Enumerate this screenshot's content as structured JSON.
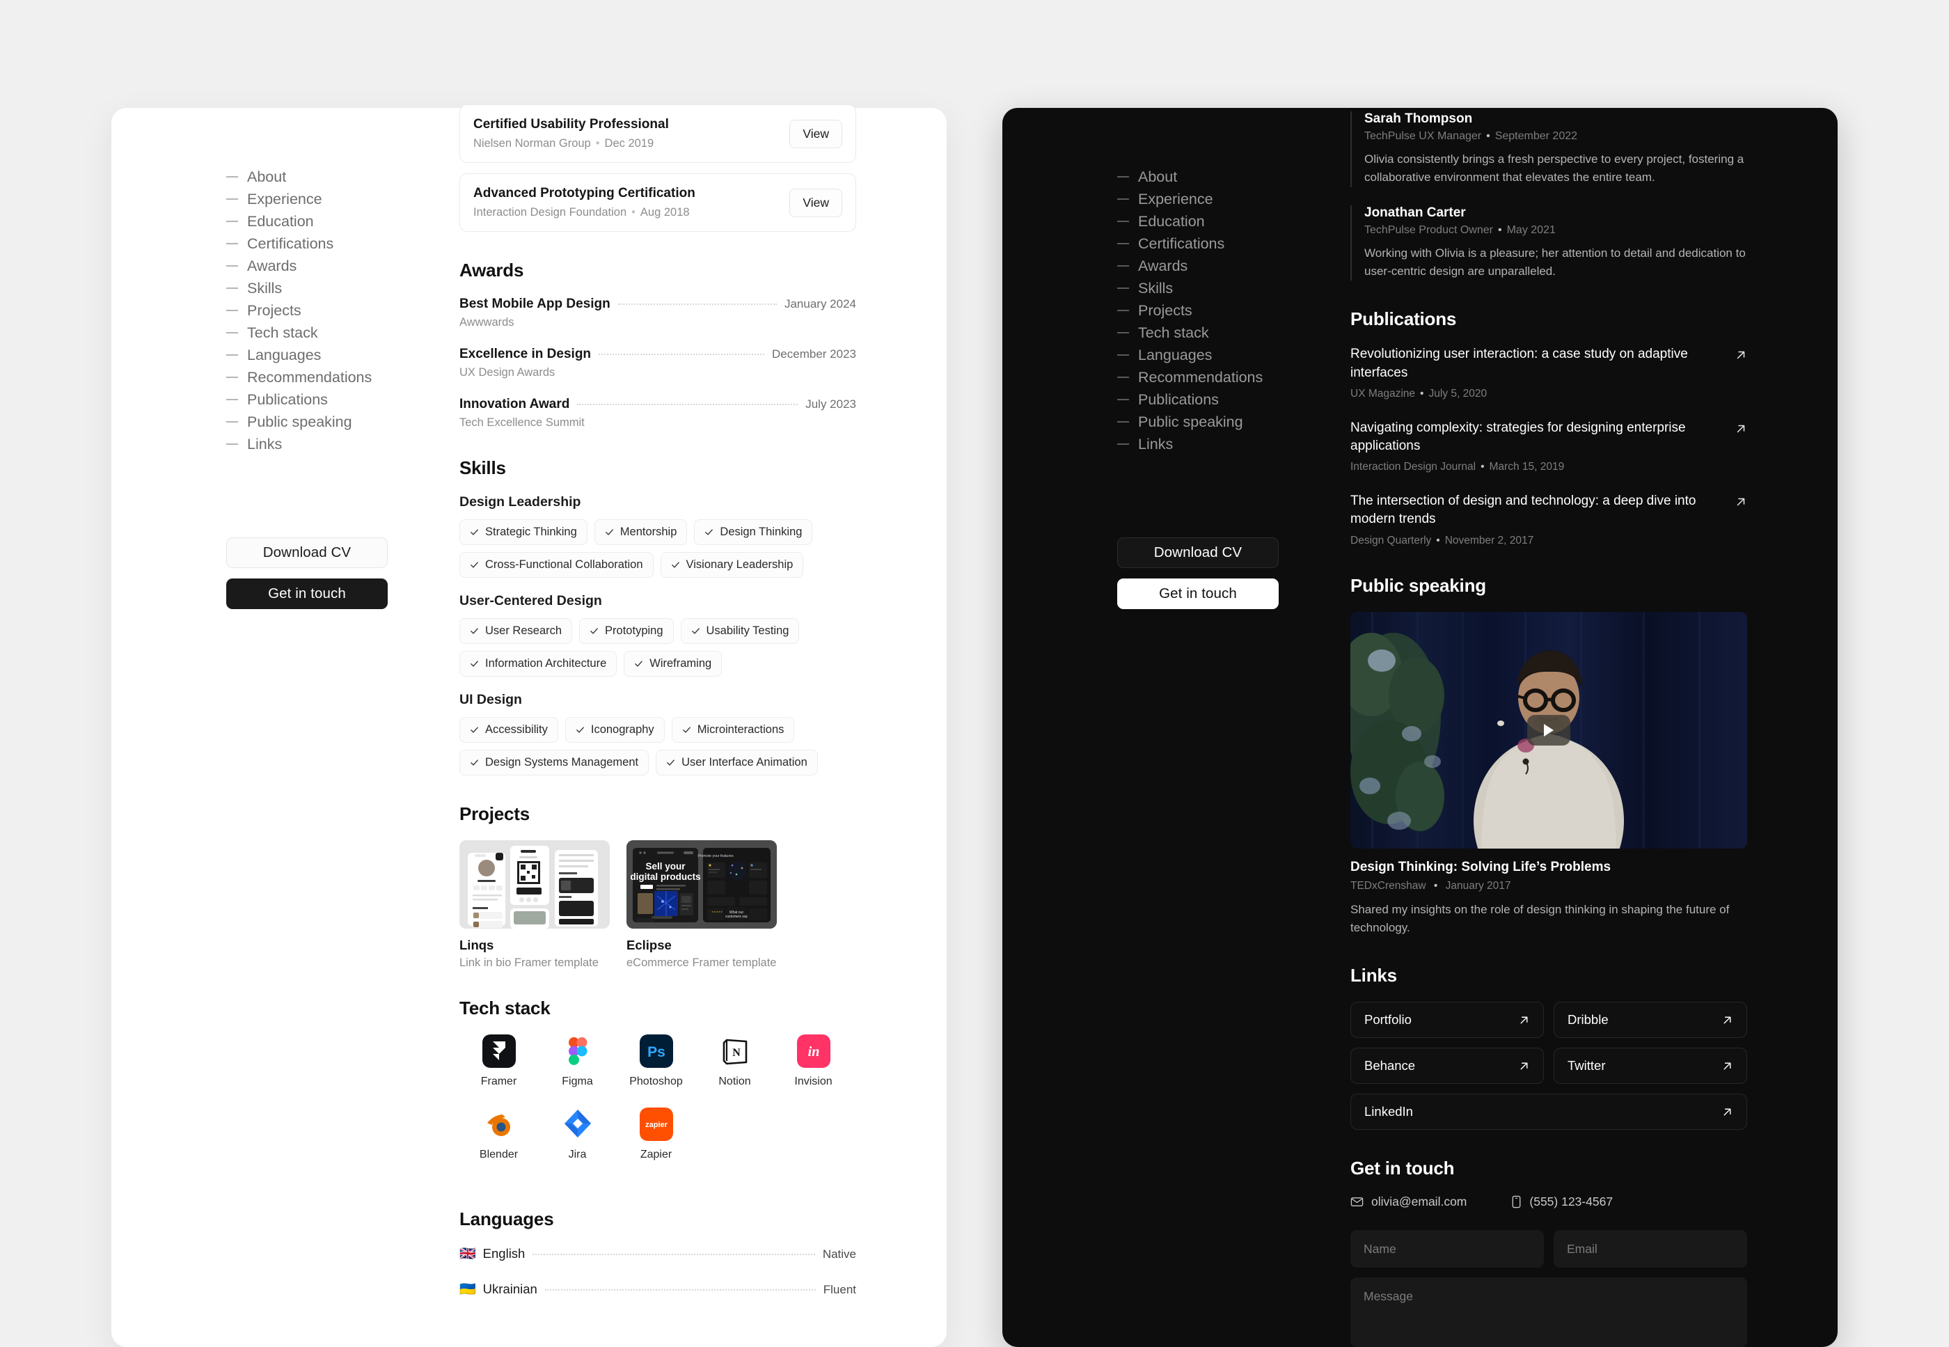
{
  "nav": {
    "items": [
      "About",
      "Experience",
      "Education",
      "Certifications",
      "Awards",
      "Skills",
      "Projects",
      "Tech stack",
      "Languages",
      "Recommendations",
      "Publications",
      "Public speaking",
      "Links"
    ],
    "download_cv": "Download CV",
    "get_in_touch": "Get in touch"
  },
  "certifications": [
    {
      "name": "Certified Usability Professional",
      "org": "Nielsen Norman Group",
      "date": "Dec 2019",
      "action": "View"
    },
    {
      "name": "Advanced Prototyping Certification",
      "org": "Interaction Design Foundation",
      "date": "Aug 2018",
      "action": "View"
    }
  ],
  "awards": {
    "title": "Awards",
    "items": [
      {
        "name": "Best Mobile App Design",
        "org": "Awwwards",
        "date": "January 2024"
      },
      {
        "name": "Excellence in Design",
        "org": "UX Design Awards",
        "date": "December 2023"
      },
      {
        "name": "Innovation Award",
        "org": "Tech Excellence Summit",
        "date": "July 2023"
      }
    ]
  },
  "skills": {
    "title": "Skills",
    "groups": [
      {
        "name": "Design Leadership",
        "items": [
          "Strategic Thinking",
          "Mentorship",
          "Design Thinking",
          "Cross-Functional Collaboration",
          "Visionary Leadership"
        ]
      },
      {
        "name": "User-Centered Design",
        "items": [
          "User Research",
          "Prototyping",
          "Usability Testing",
          "Information Architecture",
          "Wireframing"
        ]
      },
      {
        "name": "UI Design",
        "items": [
          "Accessibility",
          "Iconography",
          "Microinteractions",
          "Design Systems Management",
          "User Interface Animation"
        ]
      }
    ]
  },
  "projects": {
    "title": "Projects",
    "items": [
      {
        "name": "Linqs",
        "desc": "Link in bio Framer template"
      },
      {
        "name": "Eclipse",
        "desc": "eCommerce Framer template"
      }
    ]
  },
  "tech_stack": {
    "title": "Tech stack",
    "items": [
      {
        "name": "Framer",
        "icon": "framer-icon"
      },
      {
        "name": "Figma",
        "icon": "figma-icon"
      },
      {
        "name": "Photoshop",
        "icon": "photoshop-icon"
      },
      {
        "name": "Notion",
        "icon": "notion-icon"
      },
      {
        "name": "Invision",
        "icon": "invision-icon"
      },
      {
        "name": "Blender",
        "icon": "blender-icon"
      },
      {
        "name": "Jira",
        "icon": "jira-icon"
      },
      {
        "name": "Zapier",
        "icon": "zapier-icon"
      }
    ]
  },
  "languages": {
    "title": "Languages",
    "items": [
      {
        "flag": "🇬🇧",
        "name": "English",
        "level": "Native"
      },
      {
        "flag": "🇺🇦",
        "name": "Ukrainian",
        "level": "Fluent"
      }
    ]
  },
  "recommendations": [
    {
      "name": "Sarah Thompson",
      "role": "TechPulse UX Manager",
      "date": "September 2022",
      "text": "Olivia consistently brings a fresh perspective to every project, fostering a collaborative environment that elevates the entire team."
    },
    {
      "name": "Jonathan Carter",
      "role": "TechPulse Product Owner",
      "date": "May 2021",
      "text": "Working with Olivia is a pleasure; her attention to detail and dedication to user-centric design are unparalleled."
    }
  ],
  "publications": {
    "title": "Publications",
    "items": [
      {
        "title": "Revolutionizing user interaction: a case study on adaptive interfaces",
        "source": "UX Magazine",
        "date": "July 5, 2020"
      },
      {
        "title": "Navigating complexity: strategies for designing enterprise applications",
        "source": "Interaction Design Journal",
        "date": "March 15, 2019"
      },
      {
        "title": "The intersection of design and technology: a deep dive into modern trends",
        "source": "Design Quarterly",
        "date": "November 2, 2017"
      }
    ]
  },
  "public_speaking": {
    "title": "Public speaking",
    "talk_title": "Design Thinking: Solving Life’s Problems",
    "event": "TEDxCrenshaw",
    "date": "January 2017",
    "description": "Shared my insights on the role of design thinking in shaping the future of technology."
  },
  "links": {
    "title": "Links",
    "items": [
      "Portfolio",
      "Dribble",
      "Behance",
      "Twitter",
      "LinkedIn"
    ]
  },
  "contact": {
    "title": "Get in touch",
    "email": "olivia@email.com",
    "phone": "(555) 123-4567",
    "name_placeholder": "Name",
    "email_placeholder": "Email",
    "message_placeholder": "Message"
  },
  "colors": {
    "page_bg": "#f0f0f0",
    "light_panel": "#ffffff",
    "dark_panel": "#0d0d0d",
    "accent_dark": "#1a1a1a"
  }
}
